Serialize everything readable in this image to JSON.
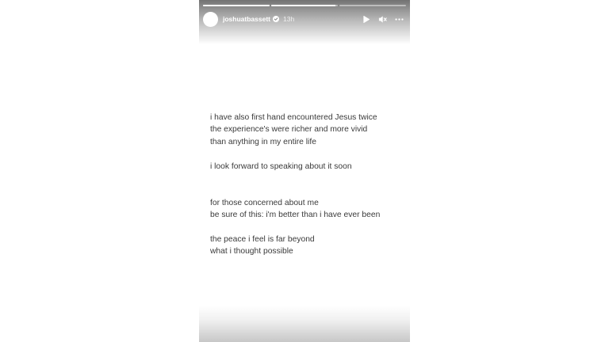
{
  "story": {
    "username": "joshuatbassett",
    "verified": true,
    "time_ago": "13h",
    "progress_segments": [
      {
        "fill": 1.0
      },
      {
        "fill": 0.97
      },
      {
        "fill": 0.0
      }
    ],
    "controls": {
      "play_icon": "play-icon",
      "mute_icon": "mute-icon",
      "more_icon": "more-options-icon"
    },
    "colors": {
      "text": "#3a3a3a",
      "background": "#ffffff"
    },
    "caption": {
      "block1": [
        "i have also first hand encountered Jesus twice",
        "the experience's were richer and more vivid",
        "than anything in my entire life"
      ],
      "block2": [
        "i look forward to speaking about it soon"
      ],
      "block3": [
        "for those concerned about me",
        "be sure of this: i'm better than i have ever been"
      ],
      "block4": [
        "the peace i feel is far beyond",
        "what i thought possible"
      ]
    }
  }
}
